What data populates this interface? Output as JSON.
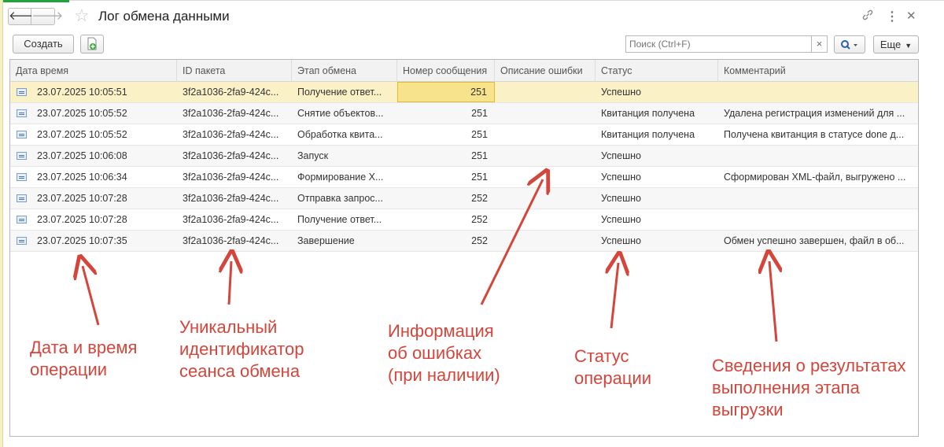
{
  "window": {
    "title": "Лог обмена данными",
    "back_icon": "arrow-left-icon",
    "forward_icon": "arrow-right-icon",
    "favorite_icon": "star-icon",
    "link_icon": "link-icon",
    "more_icon": "more-vertical-icon",
    "close_icon": "close-icon"
  },
  "toolbar": {
    "create_label": "Создать",
    "add_icon": "add-document-icon",
    "search_placeholder": "Поиск (Ctrl+F)",
    "clear_label": "×",
    "search_icon": "search-icon",
    "more_label": "Еще"
  },
  "table": {
    "columns": [
      "Дата время",
      "ID пакета",
      "Этап обмена",
      "Номер сообщения",
      "Описание ошибки",
      "Статус",
      "Комментарий"
    ],
    "rows": [
      {
        "date": "23.07.2025 10:05:51",
        "id": "3f2a1036-2fa9-424c...",
        "stage": "Получение ответ...",
        "num": "251",
        "error": "",
        "status": "Успешно",
        "comment": ""
      },
      {
        "date": "23.07.2025 10:05:52",
        "id": "3f2a1036-2fa9-424c...",
        "stage": "Снятие объектов...",
        "num": "251",
        "error": "",
        "status": "Квитанция получена",
        "comment": "Удалена регистрация изменений для ..."
      },
      {
        "date": "23.07.2025 10:05:52",
        "id": "3f2a1036-2fa9-424c...",
        "stage": "Обработка квита...",
        "num": "251",
        "error": "",
        "status": "Квитанция получена",
        "comment": "Получена квитанция в статусе done д..."
      },
      {
        "date": "23.07.2025 10:06:08",
        "id": "3f2a1036-2fa9-424c...",
        "stage": "Запуск",
        "num": "251",
        "error": "",
        "status": "Успешно",
        "comment": ""
      },
      {
        "date": "23.07.2025 10:06:34",
        "id": "3f2a1036-2fa9-424c...",
        "stage": "Формирование Х...",
        "num": "251",
        "error": "",
        "status": "Успешно",
        "comment": "Сформирован XML-файл, выгружено ..."
      },
      {
        "date": "23.07.2025 10:07:28",
        "id": "3f2a1036-2fa9-424c...",
        "stage": "Отправка запрос...",
        "num": "252",
        "error": "",
        "status": "Успешно",
        "comment": ""
      },
      {
        "date": "23.07.2025 10:07:28",
        "id": "3f2a1036-2fa9-424c...",
        "stage": "Получение ответ...",
        "num": "252",
        "error": "",
        "status": "Успешно",
        "comment": ""
      },
      {
        "date": "23.07.2025 10:07:35",
        "id": "3f2a1036-2fa9-424c...",
        "stage": "Завершение",
        "num": "252",
        "error": "",
        "status": "Успешно",
        "comment": "Обмен успешно завершен, файл в об..."
      }
    ]
  },
  "annotations": {
    "date": [
      "Дата и время",
      "операции"
    ],
    "id": [
      "Уникальный",
      "идентификатор",
      "сеанса обмена"
    ],
    "error": [
      "Информация",
      "об ошибках",
      "(при наличии)"
    ],
    "status": [
      "Статус",
      "операции"
    ],
    "comment": [
      "Сведения о результатах",
      "выполнения этапа",
      "выгрузки"
    ],
    "color": "#d4463b"
  }
}
